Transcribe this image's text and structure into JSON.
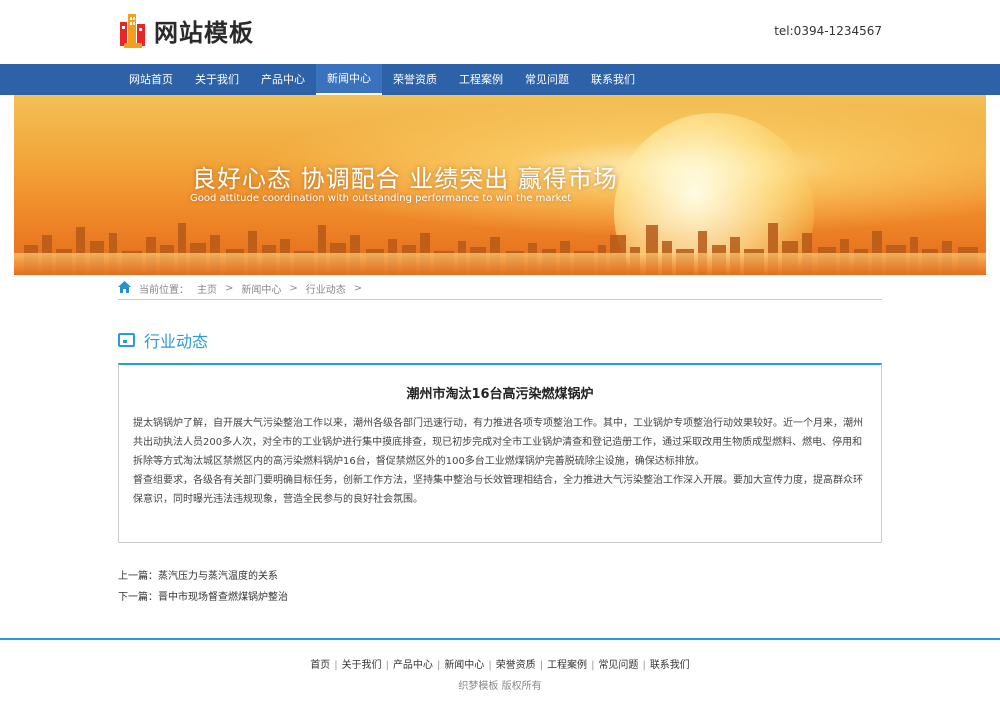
{
  "header": {
    "logo_text": "网站模板",
    "tel": "tel:0394-1234567"
  },
  "nav": {
    "items": [
      "网站首页",
      "关于我们",
      "产品中心",
      "新闻中心",
      "荣誉资质",
      "工程案例",
      "常见问题",
      "联系我们"
    ],
    "active_index": 3
  },
  "banner": {
    "title": "良好心态  协调配合  业绩突出  赢得市场",
    "subtitle": "Good attitude coordination with outstanding performance to win the market"
  },
  "breadcrumb": {
    "label": "当前位置：",
    "items": [
      "主页",
      "新闻中心",
      "行业动态"
    ],
    "separator": ">"
  },
  "section": {
    "title": "行业动态"
  },
  "article": {
    "title": "潮州市淘汰16台高污染燃煤锅炉",
    "paragraph1": "提太锅锅炉了解，自开展大气污染整治工作以来，潮州各级各部门迅速行动，有力推进各项专项整治工作。其中，工业锅炉专项整治行动效果较好。近一个月来，潮州共出动执法人员200多人次，对全市的工业锅炉进行集中摸底排查，现已初步完成对全市工业锅炉清查和登记造册工作，通过采取改用生物质成型燃料、燃电、停用和拆除等方式淘汰城区禁燃区内的高污染燃料锅炉16台，督促禁燃区外的100多台工业燃煤锅炉完善脱硫除尘设施，确保达标排放。",
    "paragraph2": "督查组要求，各级各有关部门要明确目标任务，创新工作方法，坚持集中整治与长效管理相结合，全力推进大气污染整治工作深入开展。要加大宣传力度，提高群众环保意识，同时曝光违法违规现象，营造全民参与的良好社会氛围。"
  },
  "prev_next": {
    "prev_label": "上一篇：",
    "prev_title": "蒸汽压力与蒸汽温度的关系",
    "next_label": "下一篇：",
    "next_title": "晋中市现场督查燃煤锅炉整治"
  },
  "footer": {
    "links": [
      "首页",
      "关于我们",
      "产品中心",
      "新闻中心",
      "荣誉资质",
      "工程案例",
      "常见问题",
      "联系我们"
    ],
    "copyright": "织梦模板 版权所有"
  },
  "colors": {
    "nav_bg": "#2d62a8",
    "accent": "#2b9ad8"
  }
}
